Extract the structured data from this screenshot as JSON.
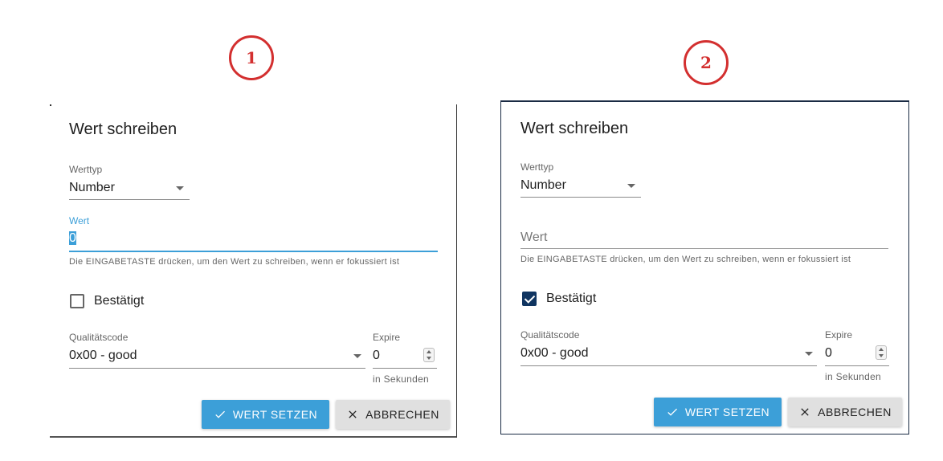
{
  "markers": [
    "1",
    "2"
  ],
  "dialogs": [
    {
      "title": "Wert schreiben",
      "type_label": "Werttyp",
      "type_value": "Number",
      "value_label": "Wert",
      "value_text": "0",
      "helper": "Die EINGABETASTE drücken, um den Wert zu schreiben, wenn er fokussiert ist",
      "ack_label": "Bestätigt",
      "ack_checked": false,
      "quality_label": "Qualitätscode",
      "quality_value": "0x00 - good",
      "expire_label": "Expire",
      "expire_value": "0",
      "expire_helper": "in Sekunden",
      "set_button": "WERT SETZEN",
      "cancel_button": "ABBRECHEN"
    },
    {
      "title": "Wert schreiben",
      "type_label": "Werttyp",
      "type_value": "Number",
      "value_placeholder": "Wert",
      "helper": "Die EINGABETASTE drücken, um den Wert zu schreiben, wenn er fokussiert ist",
      "ack_label": "Bestätigt",
      "ack_checked": true,
      "quality_label": "Qualitätscode",
      "quality_value": "0x00 - good",
      "expire_label": "Expire",
      "expire_value": "0",
      "expire_helper": "in Sekunden",
      "set_button": "WERT SETZEN",
      "cancel_button": "ABBRECHEN"
    }
  ],
  "colors": {
    "accent": "#3c9fd8",
    "checkbox_checked": "#0f3460",
    "marker": "#d32f2f"
  }
}
